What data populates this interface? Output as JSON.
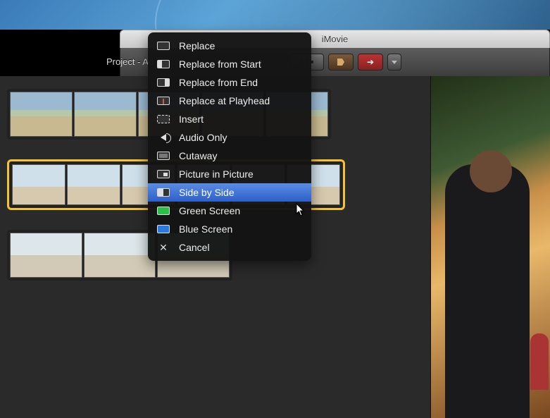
{
  "window": {
    "title": "iMovie"
  },
  "toolbar": {
    "project_label": "Project - Ad"
  },
  "menu": {
    "items": [
      {
        "id": "replace",
        "label": "Replace",
        "icon": "replace-icon"
      },
      {
        "id": "replace-start",
        "label": "Replace from Start",
        "icon": "replace-start-icon"
      },
      {
        "id": "replace-end",
        "label": "Replace from End",
        "icon": "replace-end-icon"
      },
      {
        "id": "replace-playhead",
        "label": "Replace at Playhead",
        "icon": "replace-playhead-icon"
      },
      {
        "id": "insert",
        "label": "Insert",
        "icon": "insert-icon"
      },
      {
        "id": "audio-only",
        "label": "Audio Only",
        "icon": "audio-icon"
      },
      {
        "id": "cutaway",
        "label": "Cutaway",
        "icon": "cutaway-icon"
      },
      {
        "id": "pip",
        "label": "Picture in Picture",
        "icon": "pip-icon"
      },
      {
        "id": "side-by-side",
        "label": "Side by Side",
        "icon": "side-by-side-icon",
        "highlighted": true
      },
      {
        "id": "green-screen",
        "label": "Green Screen",
        "icon": "green-screen-icon"
      },
      {
        "id": "blue-screen",
        "label": "Blue Screen",
        "icon": "blue-screen-icon"
      },
      {
        "id": "cancel",
        "label": "Cancel",
        "icon": "cancel-icon"
      }
    ]
  }
}
